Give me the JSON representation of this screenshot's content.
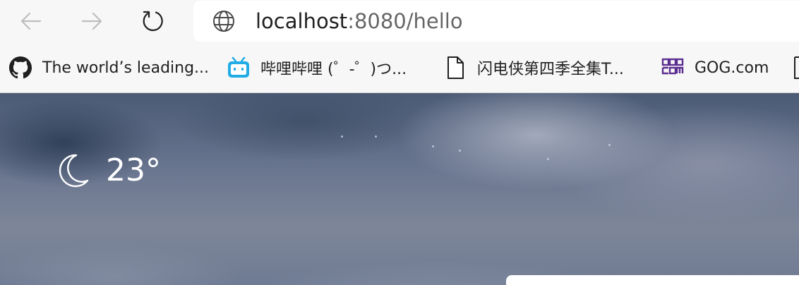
{
  "toolbar": {
    "back_icon": "arrow-left-icon",
    "forward_icon": "arrow-right-icon",
    "refresh_icon": "refresh-icon",
    "site_icon": "globe-icon",
    "url_host": "localhost",
    "url_rest": ":8080/hello"
  },
  "bookmarks": [
    {
      "icon": "github-icon",
      "label": "The world’s leading..."
    },
    {
      "icon": "bilibili-icon",
      "label": "哔哩哔哩 (゜-゜)つ..."
    },
    {
      "icon": "page-icon",
      "label": "闪电侠第四季全集T..."
    },
    {
      "icon": "gog-icon",
      "label": "GOG.com"
    },
    {
      "icon": "page-icon",
      "label": ""
    }
  ],
  "weather": {
    "icon": "moon-icon",
    "temperature": "23°"
  },
  "colors": {
    "bilibili": "#23ade5",
    "gog": "#5b2d90",
    "chrome_bg": "#f7f7f7"
  }
}
